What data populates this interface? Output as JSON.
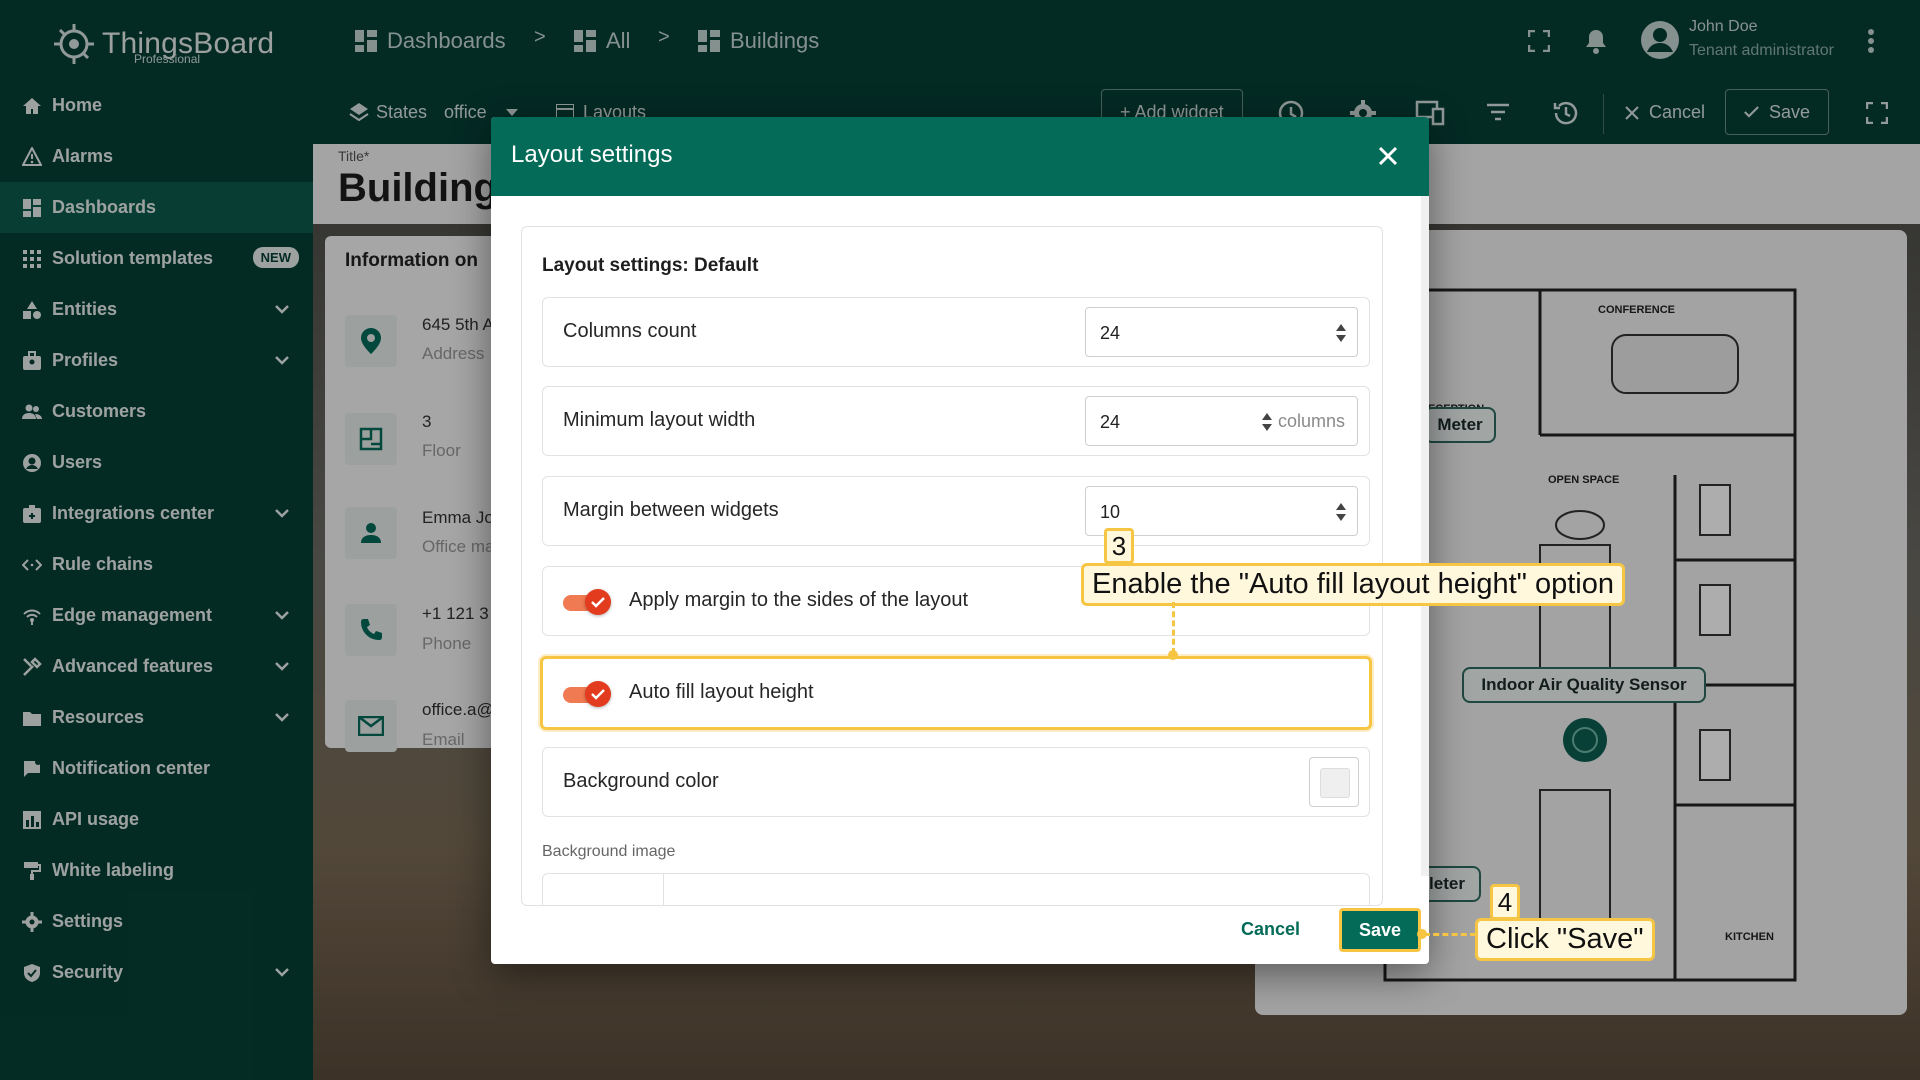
{
  "brand": {
    "name": "ThingsBoard",
    "edition": "Professional"
  },
  "sidebar": {
    "items": [
      {
        "label": "Home",
        "icon": "home-icon",
        "active": false,
        "expandable": false
      },
      {
        "label": "Alarms",
        "icon": "alarm-icon",
        "active": false,
        "expandable": false
      },
      {
        "label": "Dashboards",
        "icon": "dashboard-icon",
        "active": true,
        "expandable": false
      },
      {
        "label": "Solution templates",
        "icon": "grid-icon",
        "active": false,
        "expandable": false,
        "badge": "NEW"
      },
      {
        "label": "Entities",
        "icon": "entities-icon",
        "active": false,
        "expandable": true
      },
      {
        "label": "Profiles",
        "icon": "profiles-icon",
        "active": false,
        "expandable": true
      },
      {
        "label": "Customers",
        "icon": "customers-icon",
        "active": false,
        "expandable": false
      },
      {
        "label": "Users",
        "icon": "user-icon",
        "active": false,
        "expandable": false
      },
      {
        "label": "Integrations center",
        "icon": "integrations-icon",
        "active": false,
        "expandable": true
      },
      {
        "label": "Rule chains",
        "icon": "rule-chain-icon",
        "active": false,
        "expandable": false
      },
      {
        "label": "Edge management",
        "icon": "edge-icon",
        "active": false,
        "expandable": true
      },
      {
        "label": "Advanced features",
        "icon": "tools-icon",
        "active": false,
        "expandable": true
      },
      {
        "label": "Resources",
        "icon": "folder-icon",
        "active": false,
        "expandable": true
      },
      {
        "label": "Notification center",
        "icon": "notification-icon",
        "active": false,
        "expandable": false
      },
      {
        "label": "API usage",
        "icon": "chart-icon",
        "active": false,
        "expandable": false
      },
      {
        "label": "White labeling",
        "icon": "paint-roller-icon",
        "active": false,
        "expandable": false
      },
      {
        "label": "Settings",
        "icon": "gear-icon",
        "active": false,
        "expandable": false
      },
      {
        "label": "Security",
        "icon": "shield-icon",
        "active": false,
        "expandable": true
      }
    ]
  },
  "breadcrumb": {
    "items": [
      "Dashboards",
      "All",
      "Buildings"
    ],
    "separator": ">"
  },
  "user": {
    "name": "John Doe",
    "role": "Tenant administrator"
  },
  "toolbar": {
    "states_label": "States",
    "state_value": "office",
    "layouts_label": "Layouts",
    "add_widget_label": "+ Add widget",
    "cancel_label": "Cancel",
    "save_label": "Save"
  },
  "dashboard": {
    "title_label": "Title*",
    "title_value": "Buildings",
    "info_card_title": "Information on",
    "info_rows": [
      {
        "value": "645 5th A",
        "label": "Address",
        "icon": "location-pin-icon"
      },
      {
        "value": "3",
        "label": "Floor",
        "icon": "floor-plan-icon"
      },
      {
        "value": "Emma Jo",
        "label": "Office ma",
        "icon": "person-icon"
      },
      {
        "value": "+1 121 3",
        "label": "Phone",
        "icon": "phone-icon"
      },
      {
        "value": "office.a@",
        "label": "Email",
        "icon": "email-icon"
      }
    ],
    "plan_labels": {
      "conference": "CONFERENCE",
      "reception": "RECEPTION",
      "open_space": "OPEN SPACE",
      "kitchen": "KITCHEN",
      "meter_top": "Meter",
      "meter_bottom": "leter",
      "sensor": "Indoor Air Quality Sensor"
    }
  },
  "dialog": {
    "title": "Layout settings",
    "section_title": "Layout settings: Default",
    "fields": {
      "columns_count": {
        "label": "Columns count",
        "value": "24"
      },
      "min_layout_width": {
        "label": "Minimum layout width",
        "value": "24",
        "suffix": "columns"
      },
      "margin": {
        "label": "Margin between widgets",
        "value": "10"
      },
      "apply_margin": {
        "label": "Apply margin to the sides of the layout",
        "checked": true
      },
      "auto_fill": {
        "label": "Auto fill layout height",
        "checked": true
      },
      "background_color": {
        "label": "Background color"
      },
      "background_image": {
        "label": "Background image"
      }
    },
    "cancel_label": "Cancel",
    "save_label": "Save"
  },
  "annotations": {
    "step3_number": "3",
    "step3_text": "Enable the \"Auto fill layout height\" option",
    "step4_number": "4",
    "step4_text": "Click \"Save\""
  },
  "colors": {
    "sidebar": "#073f36",
    "active_nav": "#0d5a4c",
    "dialog_header": "#036b57",
    "toggle_on": "#e33b1e",
    "callout_border": "#f6c543"
  }
}
